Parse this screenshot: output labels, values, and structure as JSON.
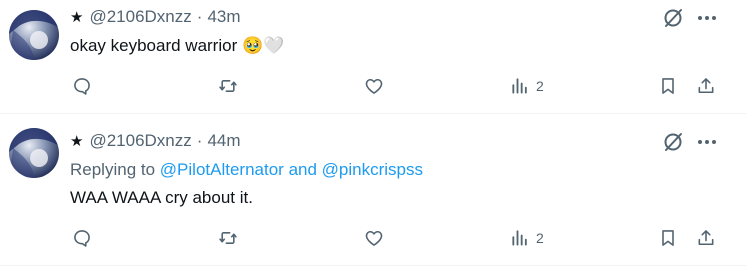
{
  "tweets": [
    {
      "handle": "@2106Dxnzz",
      "time": "43m",
      "text": "okay keyboard warrior",
      "emojis": "🥹🤍",
      "replying_prefix": "",
      "mentions": [],
      "views": "2"
    },
    {
      "handle": "@2106Dxnzz",
      "time": "44m",
      "text": "WAA WAAA cry about it.",
      "replying_prefix": "Replying to",
      "mentions": [
        "@PilotAlternator",
        "@pinkcrispss"
      ],
      "mention_joiner": "and",
      "views": "2"
    }
  ],
  "icons": {
    "star": "★",
    "dot": "·",
    "reply": "reply-icon",
    "retweet": "retweet-icon",
    "like": "heart-icon",
    "views": "analytics-icon",
    "bookmark": "bookmark-icon",
    "share": "share-icon",
    "more": "more-icon",
    "grok": "grok-icon"
  },
  "colors": {
    "text": "#0f1419",
    "secondary": "#536471",
    "accent": "#1d9bf0",
    "divider": "#eff3f4"
  }
}
